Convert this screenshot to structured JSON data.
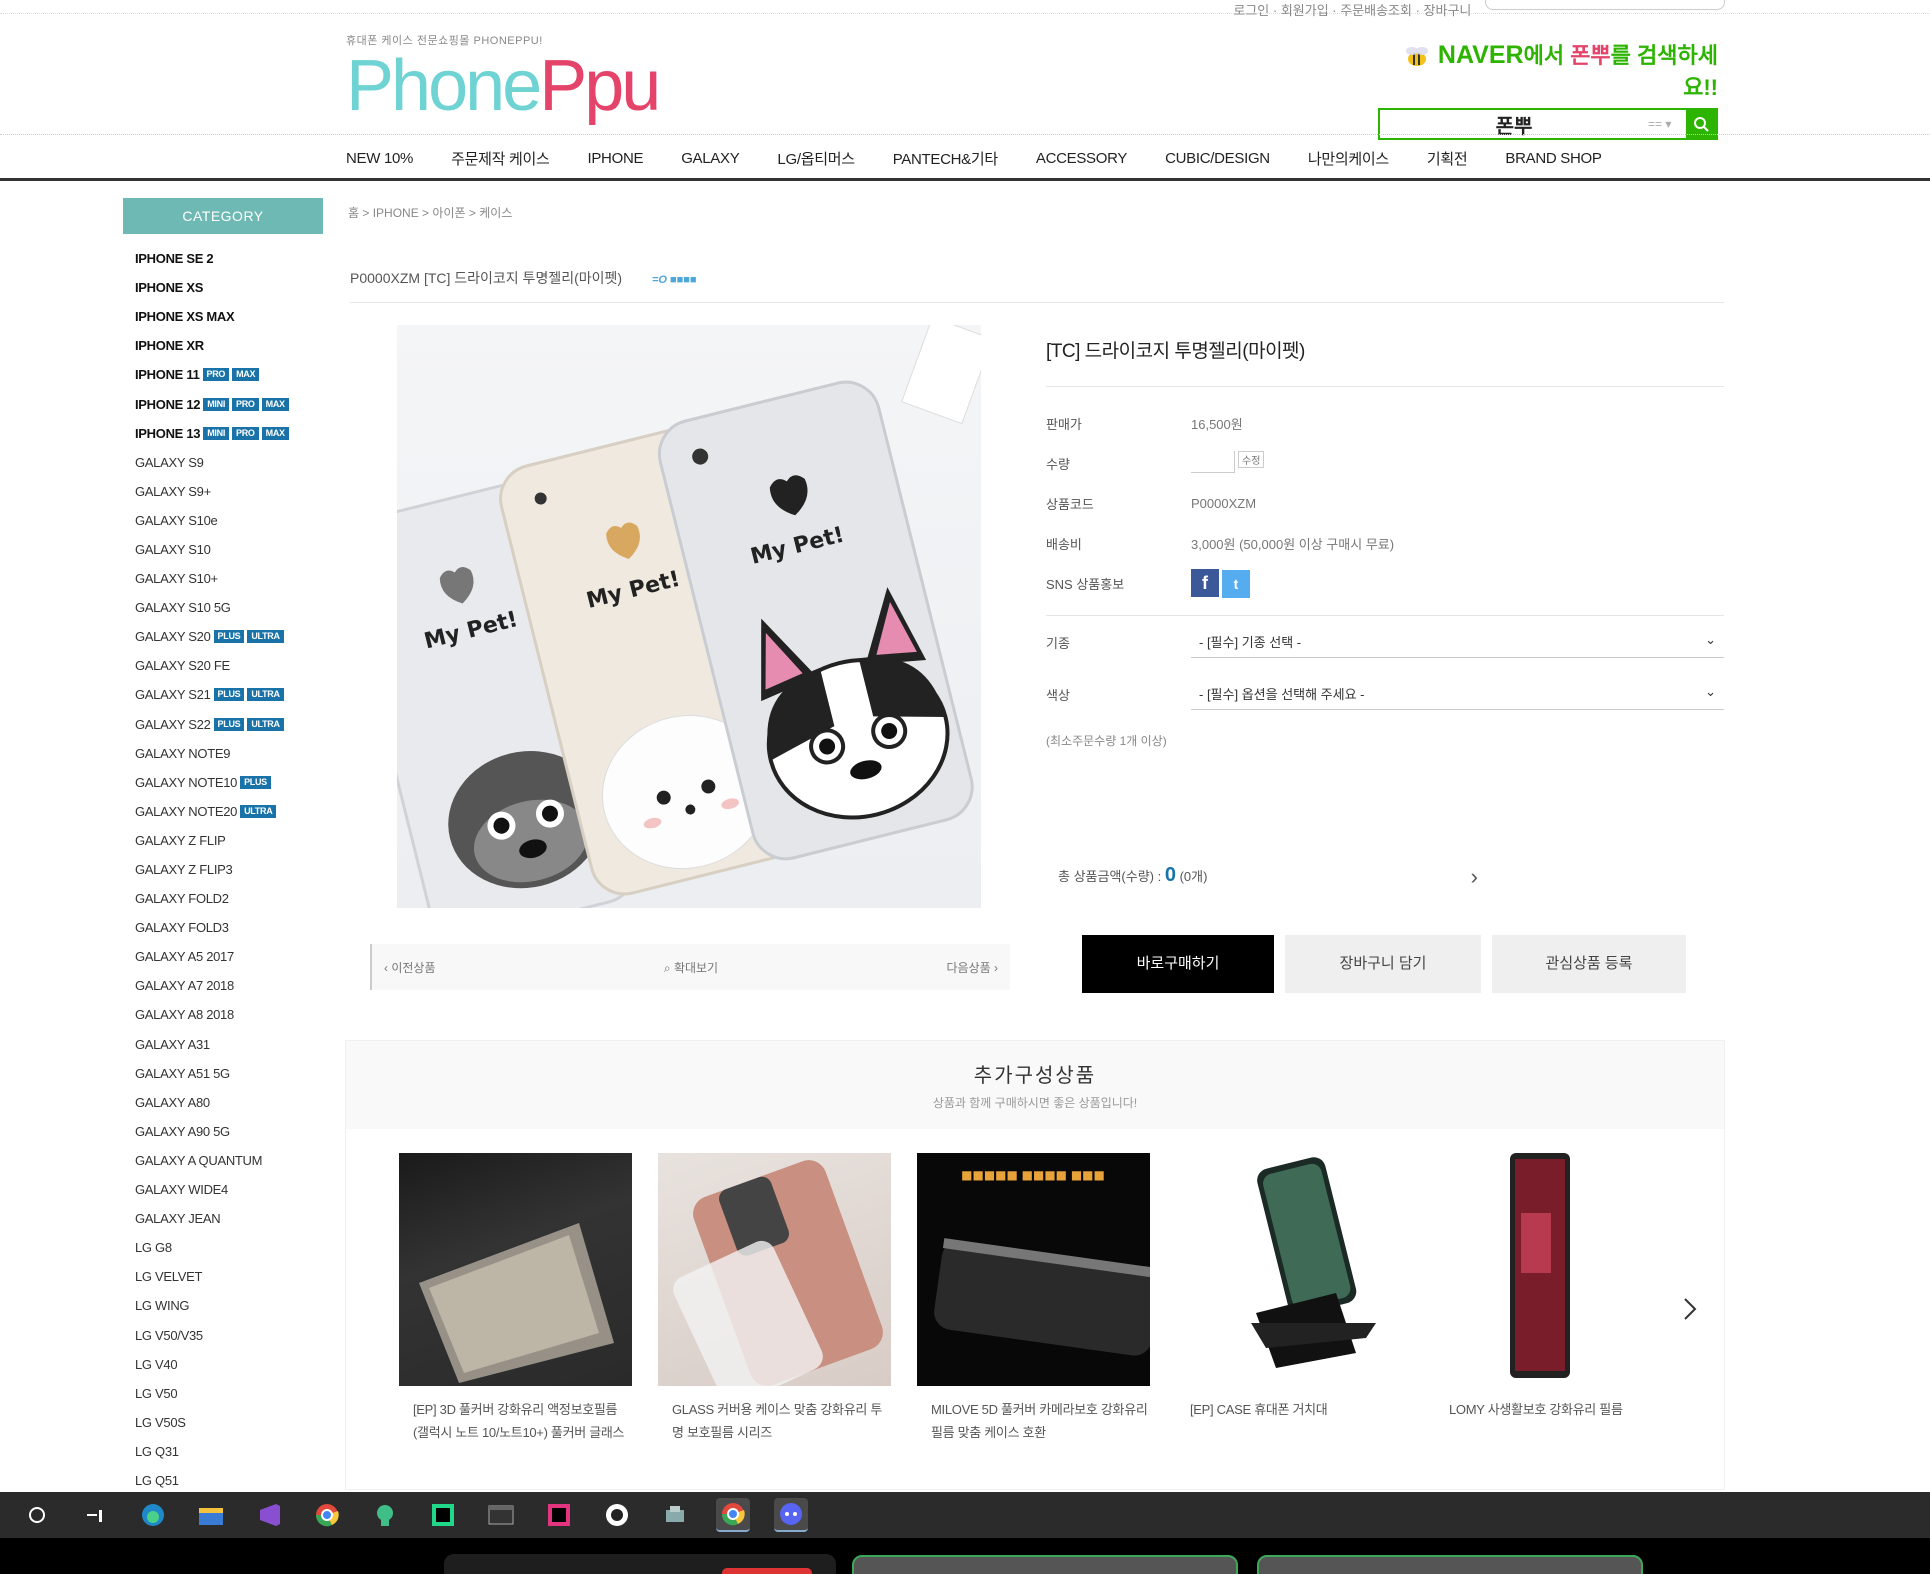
{
  "top_util": {
    "text": "로그인 · 회원가입 · 주문배송조회 · 장바구니"
  },
  "logo": {
    "sub": "휴대폰 케이스 전문쇼핑몰 PHONEPPU!",
    "part1": "Phone",
    "part2": "Ppu"
  },
  "naver": {
    "prefix": "NAVER",
    "text1": "에서 ",
    "text2": "폰뿌",
    "text3": "를 검색하세요!!",
    "query": "폰뿌",
    "dropdown": "== ▾"
  },
  "gnb": [
    "NEW 10%",
    "주문제작 케이스",
    "IPHONE",
    "GALAXY",
    "LG/옵티머스",
    "PANTECH&기타",
    "ACCESSORY",
    "CUBIC/DESIGN",
    "나만의케이스",
    "기획전",
    "BRAND SHOP"
  ],
  "sidebar": {
    "title": "CATEGORY",
    "items": [
      {
        "label": "IPHONE SE 2",
        "bold": true,
        "tags": []
      },
      {
        "label": "IPHONE XS",
        "bold": true,
        "tags": []
      },
      {
        "label": "IPHONE XS MAX",
        "bold": true,
        "tags": []
      },
      {
        "label": "IPHONE XR",
        "bold": true,
        "tags": []
      },
      {
        "label": "IPHONE 11",
        "bold": true,
        "tags": [
          "PRO",
          "MAX"
        ]
      },
      {
        "label": "IPHONE 12",
        "bold": true,
        "tags": [
          "MINI",
          "PRO",
          "MAX"
        ]
      },
      {
        "label": "IPHONE 13",
        "bold": true,
        "tags": [
          "MINI",
          "PRO",
          "MAX"
        ]
      },
      {
        "label": "GALAXY S9",
        "bold": false,
        "tags": []
      },
      {
        "label": "GALAXY S9+",
        "bold": false,
        "tags": []
      },
      {
        "label": "GALAXY S10e",
        "bold": false,
        "tags": []
      },
      {
        "label": "GALAXY S10",
        "bold": false,
        "tags": []
      },
      {
        "label": "GALAXY S10+",
        "bold": false,
        "tags": []
      },
      {
        "label": "GALAXY S10 5G",
        "bold": false,
        "tags": []
      },
      {
        "label": "GALAXY S20",
        "bold": false,
        "tags": [
          "PLUS",
          "ULTRA"
        ]
      },
      {
        "label": "GALAXY S20 FE",
        "bold": false,
        "tags": []
      },
      {
        "label": "GALAXY S21",
        "bold": false,
        "tags": [
          "PLUS",
          "ULTRA"
        ]
      },
      {
        "label": "GALAXY S22",
        "bold": false,
        "tags": [
          "PLUS",
          "ULTRA"
        ]
      },
      {
        "label": "GALAXY NOTE9",
        "bold": false,
        "tags": []
      },
      {
        "label": "GALAXY NOTE10",
        "bold": false,
        "tags": [
          "PLUS"
        ]
      },
      {
        "label": "GALAXY NOTE20",
        "bold": false,
        "tags": [
          "ULTRA"
        ]
      },
      {
        "label": "GALAXY Z FLIP",
        "bold": false,
        "tags": []
      },
      {
        "label": "GALAXY Z FLIP3",
        "bold": false,
        "tags": []
      },
      {
        "label": "GALAXY FOLD2",
        "bold": false,
        "tags": []
      },
      {
        "label": "GALAXY FOLD3",
        "bold": false,
        "tags": []
      },
      {
        "label": "GALAXY A5 2017",
        "bold": false,
        "tags": []
      },
      {
        "label": "GALAXY A7 2018",
        "bold": false,
        "tags": []
      },
      {
        "label": "GALAXY A8 2018",
        "bold": false,
        "tags": []
      },
      {
        "label": "GALAXY A31",
        "bold": false,
        "tags": []
      },
      {
        "label": "GALAXY A51 5G",
        "bold": false,
        "tags": []
      },
      {
        "label": "GALAXY A80",
        "bold": false,
        "tags": []
      },
      {
        "label": "GALAXY A90 5G",
        "bold": false,
        "tags": []
      },
      {
        "label": "GALAXY A QUANTUM",
        "bold": false,
        "tags": []
      },
      {
        "label": "GALAXY WIDE4",
        "bold": false,
        "tags": []
      },
      {
        "label": "GALAXY JEAN",
        "bold": false,
        "tags": []
      },
      {
        "label": "LG G8",
        "bold": false,
        "tags": []
      },
      {
        "label": "LG VELVET",
        "bold": false,
        "tags": []
      },
      {
        "label": "LG WING",
        "bold": false,
        "tags": []
      },
      {
        "label": "LG V50/V35",
        "bold": false,
        "tags": []
      },
      {
        "label": "LG V40",
        "bold": false,
        "tags": []
      },
      {
        "label": "LG V50",
        "bold": false,
        "tags": []
      },
      {
        "label": "LG V50S",
        "bold": false,
        "tags": []
      },
      {
        "label": "LG Q31",
        "bold": false,
        "tags": []
      },
      {
        "label": "LG Q51",
        "bold": false,
        "tags": []
      }
    ]
  },
  "breadcrumb": "홈 > IPHONE > 아이폰 > 케이스",
  "product_code_header": "P0000XZM",
  "product_header_title": "[TC] 드라이코지 투명젤리(마이펫)",
  "product_header_badge": "=O ■■■■",
  "product_title": "[TC] 드라이코지 투명젤리(마이펫)",
  "info": [
    {
      "key": "판매가",
      "value": "16,500원"
    },
    {
      "key": "수량",
      "value": ""
    },
    {
      "key": "상품코드",
      "value": "P0000XZM"
    },
    {
      "key": "배송비",
      "value": "3,000원 (50,000원 이상 구매시 무료)"
    },
    {
      "key": "SNS 상품홍보",
      "value": ""
    }
  ],
  "qty_btn": "수정",
  "options": [
    {
      "key": "기종",
      "value": "- [필수] 기종 선택 -"
    },
    {
      "key": "색상",
      "value": "- [필수] 옵션을 선택해 주세요 -"
    }
  ],
  "option_note": "(최소주문수량 1개 이상)",
  "total": {
    "label": "총 상품금액(수량) : ",
    "value": "0",
    "unit": "(0개)"
  },
  "nav_bar": {
    "prev": "‹ 이전상품",
    "zoom": "확대보기",
    "next": "다음상품 ›"
  },
  "buttons": {
    "buy": "바로구매하기",
    "cart": "장바구니 담기",
    "wish": "관심상품 등록"
  },
  "related": {
    "title": "추가구성상품",
    "subtitle": "상품과 함께 구매하시면 좋은 상품입니다!",
    "items": [
      "[EP] 3D 풀커버 강화유리 액정보호필름 (갤럭시 노트 10/노트10+) 풀커버 글래스",
      "GLASS 커버용 케이스 맞춤 강화유리 투명 보호필름 시리즈",
      "MILOVE 5D 풀커버 카메라보호 강화유리 필름 맞춤 케이스 호환",
      "[EP] CASE 휴대폰 거치대",
      "LOMY 사생활보호 강화유리 필름"
    ]
  },
  "colors": {
    "accent": "#6fb9b4",
    "brand_pink": "#e5446a",
    "brand_teal": "#6fd3d3",
    "naver_green": "#2db400"
  }
}
